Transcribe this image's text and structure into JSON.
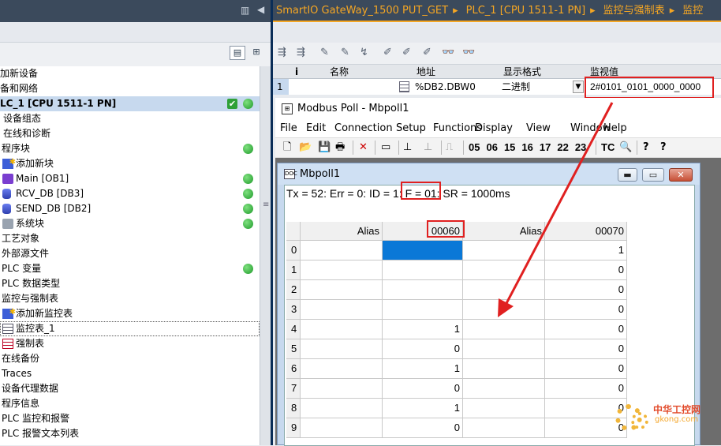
{
  "breadcrumb": {
    "items": [
      "SmartIO GateWay_1500 PUT_GET",
      "PLC_1 [CPU 1511-1 PN]",
      "监控与强制表",
      "监控"
    ],
    "separator": "▸"
  },
  "tree": {
    "items": [
      {
        "label": "加新设备",
        "indent": 0,
        "icon": "",
        "check": false,
        "online": false
      },
      {
        "label": "备和网络",
        "indent": 0,
        "icon": "",
        "check": false,
        "online": false
      },
      {
        "label": "LC_1 [CPU 1511-1 PN]",
        "indent": 0,
        "icon": "",
        "check": true,
        "online": true,
        "selected": true
      },
      {
        "label": "设备组态",
        "indent": 4,
        "icon": "",
        "check": false,
        "online": false
      },
      {
        "label": "在线和诊断",
        "indent": 4,
        "icon": "",
        "check": false,
        "online": false
      },
      {
        "label": "程序块",
        "indent": 2,
        "icon": "",
        "check": false,
        "online": true
      },
      {
        "label": "添加新块",
        "indent": 20,
        "icon": "add-block-icon",
        "check": false,
        "online": false
      },
      {
        "label": "Main [OB1]",
        "indent": 20,
        "icon": "main-block-icon",
        "check": false,
        "online": true
      },
      {
        "label": "RCV_DB [DB3]",
        "indent": 20,
        "icon": "data-block-icon",
        "check": false,
        "online": true
      },
      {
        "label": "SEND_DB [DB2]",
        "indent": 20,
        "icon": "data-block-icon",
        "check": false,
        "online": true
      },
      {
        "label": "系统块",
        "indent": 20,
        "icon": "system-block-icon",
        "check": false,
        "online": true
      },
      {
        "label": "工艺对象",
        "indent": 2,
        "icon": "",
        "check": false,
        "online": false
      },
      {
        "label": "外部源文件",
        "indent": 2,
        "icon": "",
        "check": false,
        "online": false
      },
      {
        "label": "PLC 变量",
        "indent": 2,
        "icon": "",
        "check": false,
        "online": true
      },
      {
        "label": "PLC 数据类型",
        "indent": 2,
        "icon": "",
        "check": false,
        "online": false
      },
      {
        "label": "监控与强制表",
        "indent": 2,
        "icon": "",
        "check": false,
        "online": false
      },
      {
        "label": "添加新监控表",
        "indent": 20,
        "icon": "add-watch-icon",
        "check": false,
        "online": false
      },
      {
        "label": "监控表_1",
        "indent": 20,
        "icon": "watch-table-icon",
        "check": false,
        "online": false,
        "focused": true
      },
      {
        "label": "强制表",
        "indent": 20,
        "icon": "force-table-icon",
        "check": false,
        "online": false
      },
      {
        "label": "在线备份",
        "indent": 2,
        "icon": "",
        "check": false,
        "online": false
      },
      {
        "label": "Traces",
        "indent": 2,
        "icon": "",
        "check": false,
        "online": false
      },
      {
        "label": "设备代理数据",
        "indent": 2,
        "icon": "",
        "check": false,
        "online": false
      },
      {
        "label": "程序信息",
        "indent": 2,
        "icon": "",
        "check": false,
        "online": false
      },
      {
        "label": "PLC 监控和报警",
        "indent": 2,
        "icon": "",
        "check": false,
        "online": false
      },
      {
        "label": "PLC 报警文本列表",
        "indent": 2,
        "icon": "",
        "check": false,
        "online": false
      }
    ]
  },
  "watch_table": {
    "headers": {
      "info": "i",
      "name": "名称",
      "address": "地址",
      "format": "显示格式",
      "monitor": "监视值"
    },
    "row": {
      "index": "1",
      "name": "",
      "address": "%DB2.DBW0",
      "format": "二进制",
      "monitor": "2#0101_0101_0000_0000"
    }
  },
  "modbus": {
    "window_title": "Modbus Poll - Mbpoll1",
    "menu": [
      "File",
      "Edit",
      "Connection",
      "Setup",
      "Functions",
      "Display",
      "View",
      "Window",
      "Help"
    ],
    "function_codes": [
      "05",
      "06",
      "15",
      "16",
      "17",
      "22",
      "23"
    ],
    "tc_label": "TC",
    "child_title": "Mbpoll1",
    "status": {
      "part1": "Tx = 52: Err = 0: ID = 1: ",
      "fc": "F = 01",
      "part2": ": SR = 1000ms"
    },
    "columns": [
      "Alias",
      "00060",
      "Alias",
      "00070"
    ],
    "rows": [
      {
        "idx": "0",
        "a1": "",
        "v1": "",
        "a2": "",
        "v2": "1"
      },
      {
        "idx": "1",
        "a1": "",
        "v1": "",
        "a2": "",
        "v2": "0"
      },
      {
        "idx": "2",
        "a1": "",
        "v1": "",
        "a2": "",
        "v2": "0"
      },
      {
        "idx": "3",
        "a1": "",
        "v1": "",
        "a2": "",
        "v2": "0"
      },
      {
        "idx": "4",
        "a1": "",
        "v1": "1",
        "a2": "",
        "v2": "0"
      },
      {
        "idx": "5",
        "a1": "",
        "v1": "0",
        "a2": "",
        "v2": "0"
      },
      {
        "idx": "6",
        "a1": "",
        "v1": "1",
        "a2": "",
        "v2": "0"
      },
      {
        "idx": "7",
        "a1": "",
        "v1": "0",
        "a2": "",
        "v2": "0"
      },
      {
        "idx": "8",
        "a1": "",
        "v1": "1",
        "a2": "",
        "v2": "0"
      },
      {
        "idx": "9",
        "a1": "",
        "v1": "0",
        "a2": "",
        "v2": "0"
      }
    ]
  },
  "watermark": {
    "line1": "中华工控网",
    "line2": "gkong.com"
  },
  "colors": {
    "accent": "#f5a623",
    "highlight": "#e02020",
    "online": "#1e9a2a",
    "selection": "#0a78d7"
  }
}
